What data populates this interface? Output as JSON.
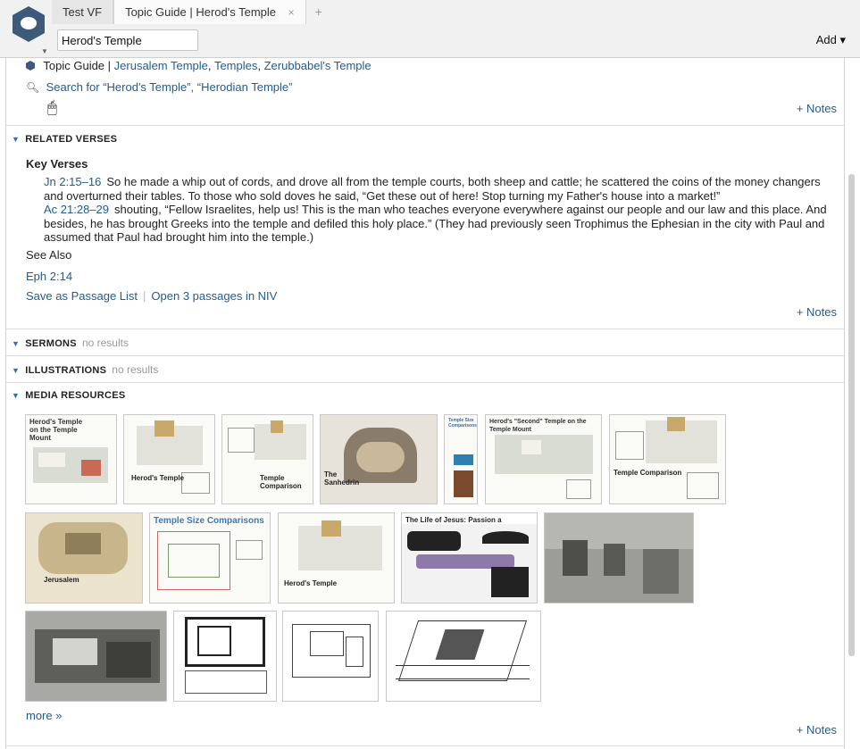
{
  "tabs": [
    {
      "label": "Test VF"
    },
    {
      "label": "Topic Guide | Herod's Temple",
      "close": "×"
    }
  ],
  "tab_add": "+",
  "search": {
    "value": "Herod's Temple"
  },
  "add_button": {
    "label": "Add ▾"
  },
  "topic_guide": {
    "prefix": "Topic Guide |",
    "links": [
      "Jerusalem Temple",
      "Temples",
      "Zerubbabel's Temple"
    ],
    "separator": ","
  },
  "search_for": "Search for “Herod's Temple”, “Herodian Temple”",
  "notes_label": "+ Notes",
  "sections": {
    "related_verses": "RELATED VERSES",
    "sermons": "SERMONS",
    "illustrations": "ILLUSTRATIONS",
    "media_resources": "MEDIA RESOURCES",
    "no_results": "no results"
  },
  "key_verses": {
    "title": "Key Verses",
    "verses": [
      {
        "ref": "Jn 2:15–16",
        "text": "So he made a whip out of cords, and drove all from the temple courts, both sheep and cattle; he scattered the coins of the money changers and overturned their tables. To those who sold doves he said, “Get these out of here! Stop turning my Father's house into a market!”"
      },
      {
        "ref": "Ac 21:28–29",
        "text": "shouting, “Fellow Israelites, help us! This is the man who teaches everyone everywhere against our people and our law and this place. And besides, he has brought Greeks into the temple and defiled this holy place.” (They had previously seen Trophimus the Ephesian in the city with Paul and assumed that Paul had brought him into the temple.)"
      }
    ]
  },
  "see_also": {
    "label": "See Also",
    "refs": [
      "Eph 2:14"
    ]
  },
  "passage_actions": {
    "save": "Save as Passage List",
    "open": "Open 3 passages in NIV"
  },
  "media": {
    "row1": [
      {
        "title": "Herod's Temple on the Temple Mount"
      },
      {
        "caption": "Herod's Temple"
      },
      {
        "caption": "Temple Comparison"
      },
      {
        "caption": "The Sanhedrin"
      },
      {
        "caption": "Temple Size Comparisons"
      },
      {
        "title": "Herod's \"Second\" Temple on the Temple Mount"
      },
      {
        "caption": "Temple Comparison"
      }
    ],
    "row2": [
      {
        "caption": "Jerusalem"
      },
      {
        "title": "Temple Size Comparisons"
      },
      {
        "caption": "Herod's Temple"
      },
      {
        "title": "The Life of Jesus: Passion a"
      },
      {
        "caption": ""
      }
    ],
    "row3": [
      {},
      {},
      {},
      {}
    ],
    "more": "more »"
  },
  "colors": {
    "link": "#1f5c8f",
    "accent": "#2f6fb0",
    "logo": "#3e5a7a"
  }
}
